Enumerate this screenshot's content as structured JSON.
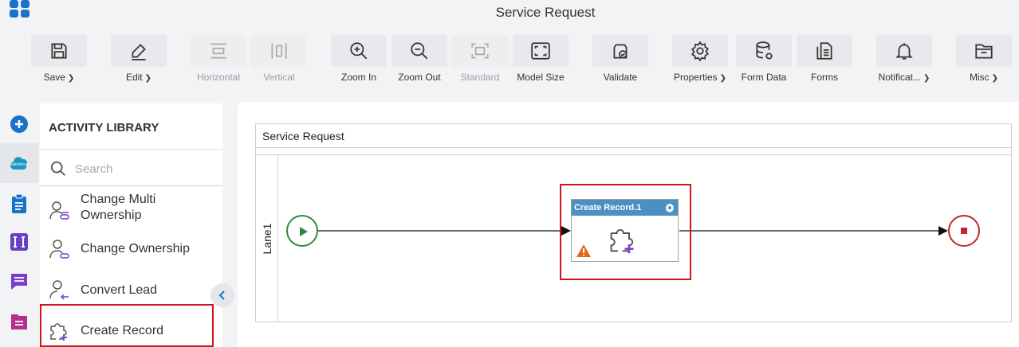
{
  "window": {
    "title": "Service Request"
  },
  "toolbar": {
    "save": "Save",
    "edit": "Edit",
    "horizontal": "Horizontal",
    "vertical": "Vertical",
    "zoom_in": "Zoom In",
    "zoom_out": "Zoom Out",
    "standard": "Standard",
    "model_size": "Model Size",
    "validate": "Validate",
    "properties": "Properties",
    "form_data": "Form Data",
    "forms": "Forms",
    "notifications": "Notificat...",
    "misc": "Misc"
  },
  "rail": {
    "items": [
      "add-icon",
      "salesforce-icon",
      "clipboard-icon",
      "form-icon",
      "chat-icon",
      "list-icon"
    ],
    "salesforce_text": "salesforce"
  },
  "library": {
    "title": "ACTIVITY LIBRARY",
    "search_placeholder": "Search",
    "items": [
      {
        "label": "Change Multi Ownership",
        "line1": "Change Multi",
        "line2": "Ownership"
      },
      {
        "label": "Change Ownership"
      },
      {
        "label": "Convert Lead"
      },
      {
        "label": "Create Record"
      }
    ]
  },
  "canvas": {
    "pool_title": "Service Request",
    "lane_label": "Lane1",
    "task_title": "Create Record.1"
  },
  "colors": {
    "accent": "#1a73c8",
    "highlight": "#d0141c",
    "start_event": "#2e8b3e",
    "end_event": "#c0282e",
    "task_header": "#4a90c2",
    "warning": "#e06a1b"
  }
}
